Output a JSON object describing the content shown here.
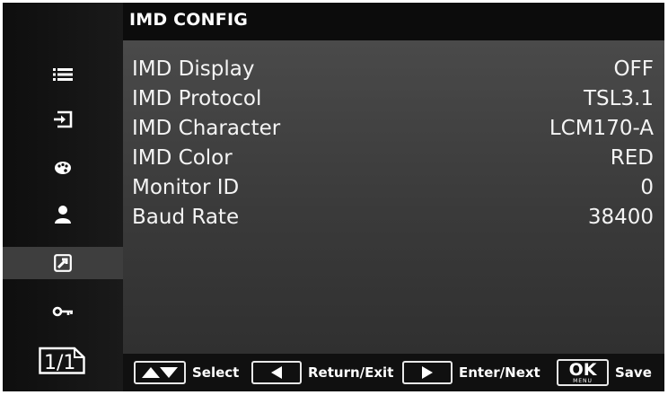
{
  "title": "IMD CONFIG",
  "sidebar": {
    "items": [
      {
        "icon": "list-icon"
      },
      {
        "icon": "input-icon"
      },
      {
        "icon": "palette-icon"
      },
      {
        "icon": "user-icon"
      },
      {
        "icon": "config-icon",
        "selected": true
      },
      {
        "icon": "key-icon"
      }
    ],
    "page_indicator": "1/1"
  },
  "settings": [
    {
      "label": "IMD Display",
      "value": "OFF"
    },
    {
      "label": "IMD Protocol",
      "value": "TSL3.1"
    },
    {
      "label": "IMD Character",
      "value": "LCM170-A"
    },
    {
      "label": "IMD Color",
      "value": "RED"
    },
    {
      "label": "Monitor ID",
      "value": "0"
    },
    {
      "label": "Baud Rate",
      "value": "38400"
    }
  ],
  "hints": {
    "select": "Select",
    "return": "Return/Exit",
    "enter": "Enter/Next",
    "ok_key": "OK",
    "ok_key_sub": "MENU",
    "save": "Save"
  },
  "colors": {
    "background": "#0c0c0c",
    "panel": "#3e3e3e",
    "text": "#f4f4f4",
    "selected_item": "#3e3e3e"
  }
}
